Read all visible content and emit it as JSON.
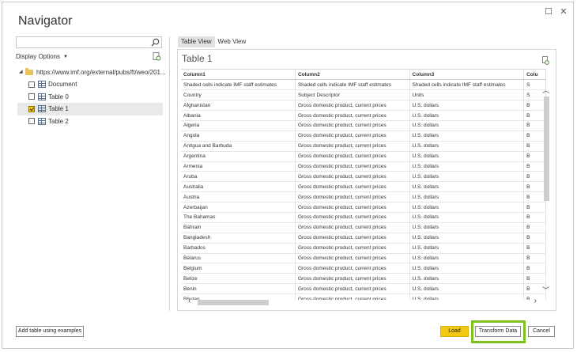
{
  "window": {
    "title": "Navigator",
    "maximize_glyph": "☐",
    "close_glyph": "✕"
  },
  "left_panel": {
    "search_placeholder": "",
    "display_options_label": "Display Options",
    "display_options_caret": "▼",
    "tree": {
      "root": {
        "expander": "◢",
        "label": "https://www.imf.org/external/pubs/ft/weo/201..."
      },
      "items": [
        {
          "label": "Document",
          "checked": false,
          "selected": false
        },
        {
          "label": "Table 0",
          "checked": false,
          "selected": false
        },
        {
          "label": "Table 1",
          "checked": true,
          "selected": true
        },
        {
          "label": "Table 2",
          "checked": false,
          "selected": false
        }
      ]
    }
  },
  "right_panel": {
    "tabs": [
      {
        "label": "Table View",
        "active": true
      },
      {
        "label": "Web View",
        "active": false
      }
    ],
    "preview_title": "Table 1",
    "table": {
      "headers": [
        "Column1",
        "Column2",
        "Column3",
        "Colu"
      ],
      "rows": [
        [
          "Shaded cells indicate IMF staff estimates",
          "Shaded cells indicate IMF staff estimates",
          "Shaded cells indicate IMF staff estimates",
          "S"
        ],
        [
          "Country",
          "Subject Descriptor",
          "Units",
          "S"
        ],
        [
          "Afghanistan",
          "Gross domestic product, current prices",
          "U.S. dollars",
          "B"
        ],
        [
          "Albania",
          "Gross domestic product, current prices",
          "U.S. dollars",
          "B"
        ],
        [
          "Algeria",
          "Gross domestic product, current prices",
          "U.S. dollars",
          "B"
        ],
        [
          "Angola",
          "Gross domestic product, current prices",
          "U.S. dollars",
          "B"
        ],
        [
          "Antigua and Barbuda",
          "Gross domestic product, current prices",
          "U.S. dollars",
          "B"
        ],
        [
          "Argentina",
          "Gross domestic product, current prices",
          "U.S. dollars",
          "B"
        ],
        [
          "Armenia",
          "Gross domestic product, current prices",
          "U.S. dollars",
          "B"
        ],
        [
          "Aruba",
          "Gross domestic product, current prices",
          "U.S. dollars",
          "B"
        ],
        [
          "Australia",
          "Gross domestic product, current prices",
          "U.S. dollars",
          "B"
        ],
        [
          "Austria",
          "Gross domestic product, current prices",
          "U.S. dollars",
          "B"
        ],
        [
          "Azerbaijan",
          "Gross domestic product, current prices",
          "U.S. dollars",
          "B"
        ],
        [
          "The Bahamas",
          "Gross domestic product, current prices",
          "U.S. dollars",
          "B"
        ],
        [
          "Bahrain",
          "Gross domestic product, current prices",
          "U.S. dollars",
          "B"
        ],
        [
          "Bangladesh",
          "Gross domestic product, current prices",
          "U.S. dollars",
          "B"
        ],
        [
          "Barbados",
          "Gross domestic product, current prices",
          "U.S. dollars",
          "B"
        ],
        [
          "Belarus",
          "Gross domestic product, current prices",
          "U.S. dollars",
          "B"
        ],
        [
          "Belgium",
          "Gross domestic product, current prices",
          "U.S. dollars",
          "B"
        ],
        [
          "Belize",
          "Gross domestic product, current prices",
          "U.S. dollars",
          "B"
        ],
        [
          "Benin",
          "Gross domestic product, current prices",
          "U.S. dollars",
          "B"
        ],
        [
          "Bhutan",
          "Gross domestic product, current prices",
          "U.S. dollars",
          "B"
        ]
      ]
    },
    "scroll": {
      "up": "︿",
      "down": "﹀",
      "left": "‹",
      "right": "›"
    }
  },
  "footer": {
    "add_table_label": "Add table using examples",
    "load_label": "Load",
    "transform_label": "Transform Data",
    "cancel_label": "Cancel"
  },
  "colors": {
    "load_button": "#f2c811",
    "highlight_box": "#7ec120",
    "checkbox_checked": "#f2c811"
  }
}
